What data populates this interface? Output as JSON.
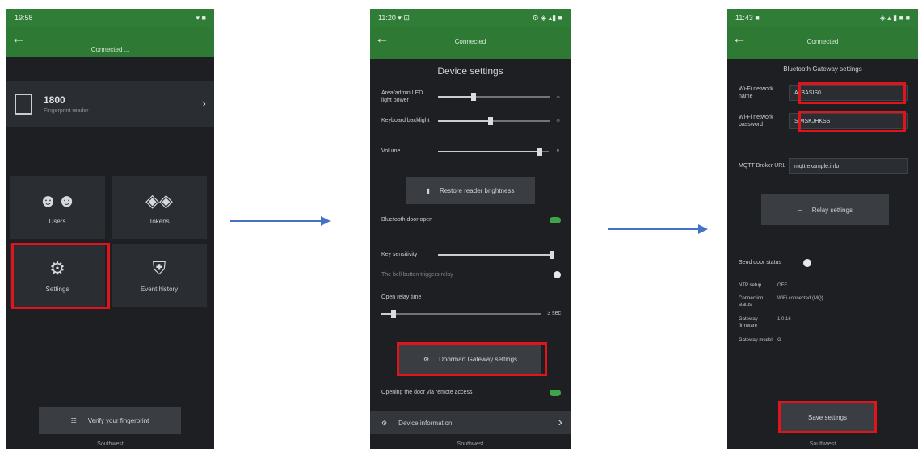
{
  "screens": [
    {
      "status_left": "19:58",
      "status_right": "▾ ■",
      "appbar_title": "Connected ...",
      "device": {
        "name": "1800",
        "subtitle": "Fingerprint reader"
      },
      "tiles": [
        {
          "label": "Users",
          "icon": "users-icon"
        },
        {
          "label": "Tokens",
          "icon": "tokens-icon"
        },
        {
          "label": "Settings",
          "icon": "settings-gear-icon"
        },
        {
          "label": "Event history",
          "icon": "shield-lock-icon"
        }
      ],
      "verify_button": "Verify your fingerprint",
      "bottom_label": "Southwest"
    },
    {
      "status_left": "11:20 ▾ ⊡",
      "status_right": "⚙ ◈ ▴▮ ■",
      "appbar_title": "Connected",
      "section_title": "Device settings",
      "rows": [
        {
          "label": "Area/admin LED light power"
        },
        {
          "label": "Keyboard backlight"
        },
        {
          "label": "Volume"
        }
      ],
      "restore_button": "Restore reader brightness",
      "bluetooth_label": "Bluetooth door open",
      "key_sensitivity": "Key sensitivity",
      "bell_label": "The bell button triggers relay",
      "open_relay_label": "Open relay time",
      "open_relay_value": "3 sec",
      "gateway_button": "Doormart Gateway settings",
      "remote_access_label": "Opening the door via remote access",
      "device_info": "Device information",
      "bottom_label": "Southwest"
    },
    {
      "status_left": "11:43 ■",
      "status_right": "◈ ▴ ▮ ■ ■",
      "appbar_title": "Connected",
      "section_title": "Bluetooth Gateway settings",
      "wifi_name_label": "Wi-Fi network name",
      "wifi_name_value": "ATBASIS0",
      "wifi_pass_label": "Wi-Fi network password",
      "wifi_pass_value": "SIMSKJHKSS",
      "mqtt_label": "MQTT Broker URL",
      "mqtt_value": "mqtt.example.info",
      "relay_button": "Relay settings",
      "send_status_label": "Send door status",
      "kv": [
        {
          "k": "NTP setup",
          "v": "OFF"
        },
        {
          "k": "Connection status",
          "v": "WiFi connected (MQ)"
        },
        {
          "k": "Gateway firmware",
          "v": "1.0.16"
        },
        {
          "k": "Gateway model",
          "v": "G"
        }
      ],
      "save_button": "Save settings",
      "bottom_label": "Southwest"
    }
  ],
  "colors": {
    "appbar": "#2e7a34",
    "highlight": "#e1141b",
    "arrow": "#4472c4",
    "screen_bg": "#1d1f22"
  }
}
